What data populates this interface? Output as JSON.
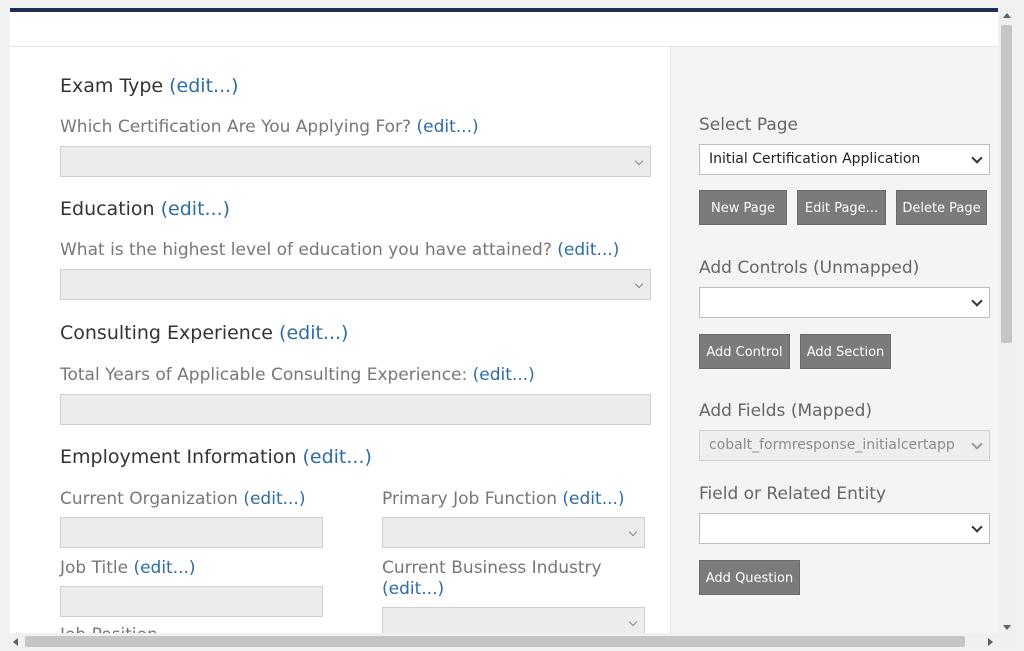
{
  "form": {
    "exam_type": {
      "heading": "Exam Type",
      "edit": "(edit...)"
    },
    "certification": {
      "question": "Which Certification Are You Applying For?",
      "edit": "(edit...)"
    },
    "education": {
      "heading": "Education",
      "edit": "(edit...)"
    },
    "education_level": {
      "question": "What is the highest level of education you have attained?",
      "edit": "(edit...)"
    },
    "consulting": {
      "heading": "Consulting Experience",
      "edit": "(edit...)"
    },
    "consulting_years": {
      "question": "Total Years of Applicable Consulting Experience:",
      "edit": "(edit...)"
    },
    "employment": {
      "heading": "Employment Information",
      "edit": "(edit...)"
    },
    "current_org": {
      "question": "Current Organization",
      "edit": "(edit...)"
    },
    "primary_job": {
      "question": "Primary Job Function",
      "edit": "(edit...)"
    },
    "job_title": {
      "question": "Job Title",
      "edit": "(edit...)"
    },
    "business_industry": {
      "question": "Current Business Industry",
      "edit": "(edit...)"
    },
    "job_position": {
      "question": "Job Position",
      "edit": "(edit...)"
    }
  },
  "sidebar": {
    "select_page": {
      "label": "Select Page",
      "value": "Initial Certification Application"
    },
    "page_buttons": {
      "new": "New Page",
      "edit": "Edit Page...",
      "delete": "Delete Page"
    },
    "add_controls": {
      "label": "Add Controls (Unmapped)",
      "value": ""
    },
    "control_buttons": {
      "add_control": "Add Control",
      "add_section": "Add Section"
    },
    "add_fields": {
      "label": "Add Fields (Mapped)",
      "value": "cobalt_formresponse_initialcertapp"
    },
    "field_entity": {
      "label": "Field or Related Entity",
      "value": ""
    },
    "question_button": "Add Question"
  }
}
